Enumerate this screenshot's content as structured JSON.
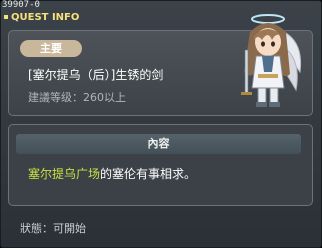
{
  "window": {
    "quest_id": "39907-0",
    "title": "QUEST INFO"
  },
  "summary": {
    "tag": "主要",
    "quest_name": "[塞尔提乌（后）]生锈的剑",
    "level_requirement": "建議等级：260以上"
  },
  "details": {
    "header": "內容",
    "highlight_location": "塞尔提乌广场",
    "description_rest": "的塞伦有事相求。"
  },
  "status": {
    "text": "狀態：可開始"
  },
  "colors": {
    "title": "#f7e17a",
    "tag_bg": "#c8b79a",
    "highlight": "#c9e044"
  },
  "icons": {
    "npc": "npc-portrait-icon"
  }
}
